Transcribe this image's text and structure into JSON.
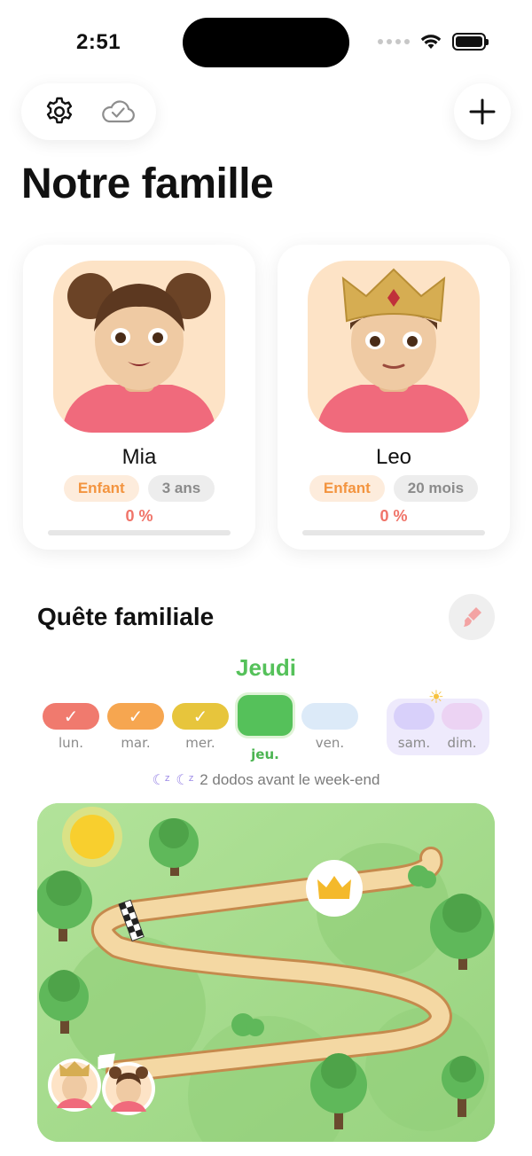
{
  "status_bar": {
    "time": "2:51"
  },
  "header": {
    "title": "Notre famille"
  },
  "members": [
    {
      "name": "Mia",
      "role": "Enfant",
      "age": "3 ans",
      "progress_text": "0 %",
      "progress": 0
    },
    {
      "name": "Leo",
      "role": "Enfant",
      "age": "20 mois",
      "progress_text": "0 %",
      "progress": 0
    }
  ],
  "quest": {
    "title": "Quête familiale",
    "current_day": "Jeudi",
    "days": [
      {
        "label": "lun.",
        "done": true,
        "color": "#f07a6e"
      },
      {
        "label": "mar.",
        "done": true,
        "color": "#f6a650"
      },
      {
        "label": "mer.",
        "done": true,
        "color": "#e7c53c"
      },
      {
        "label": "jeu.",
        "today": true,
        "color": "#55c15a"
      },
      {
        "label": "ven.",
        "color": "#dceaf8"
      },
      {
        "label": "sam.",
        "color": "#d8d0fa"
      },
      {
        "label": "dim.",
        "color": "#ecd3f3"
      }
    ],
    "sleeps_text": "2 dodos avant le week-end"
  },
  "colors": {
    "accent_green": "#55c15a",
    "percent_red": "#f07469",
    "badge_orange": "#f3943f"
  },
  "icons": [
    "gear-icon",
    "cloud-check-icon",
    "plus-icon",
    "brush-icon",
    "moon-icon",
    "crown-icon",
    "finish-flag-icon",
    "sun-icon"
  ]
}
